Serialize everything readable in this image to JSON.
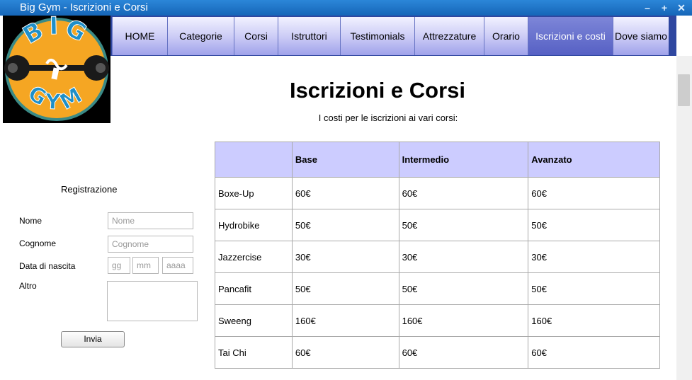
{
  "window": {
    "title": "Big Gym - Iscrizioni e Corsi"
  },
  "logo": {
    "top_text": "BIG",
    "bottom_text": "GYM"
  },
  "nav": {
    "items": [
      {
        "label": "HOME",
        "active": false
      },
      {
        "label": "Categorie",
        "active": false
      },
      {
        "label": "Corsi",
        "active": false
      },
      {
        "label": "Istruttori",
        "active": false
      },
      {
        "label": "Testimonials",
        "active": false
      },
      {
        "label": "Attrezzature",
        "active": false
      },
      {
        "label": "Orario",
        "active": false
      },
      {
        "label": "Iscrizioni e costi",
        "active": true
      },
      {
        "label": "Dove siamo",
        "active": false
      }
    ]
  },
  "main": {
    "title": "Iscrizioni e Corsi",
    "subtitle": "I costi per le iscrizioni ai vari corsi:"
  },
  "form": {
    "title": "Registrazione",
    "name_label": "Nome",
    "name_placeholder": "Nome",
    "surname_label": "Cognome",
    "surname_placeholder": "Cognome",
    "dob_label": "Data di nascita",
    "dob_day_placeholder": "gg",
    "dob_month_placeholder": "mm",
    "dob_year_placeholder": "aaaa",
    "other_label": "Altro",
    "submit_label": "Invia"
  },
  "table": {
    "headers": [
      "",
      "Base",
      "Intermedio",
      "Avanzato"
    ],
    "rows": [
      [
        "Boxe-Up",
        "60€",
        "60€",
        "60€"
      ],
      [
        "Hydrobike",
        "50€",
        "50€",
        "50€"
      ],
      [
        "Jazzercise",
        "30€",
        "30€",
        "30€"
      ],
      [
        "Pancafit",
        "50€",
        "50€",
        "50€"
      ],
      [
        "Sweeng",
        "160€",
        "160€",
        "160€"
      ],
      [
        "Tai Chi",
        "60€",
        "60€",
        "60€"
      ]
    ]
  },
  "colors": {
    "titlebar": "#1e76cc",
    "nav_border": "#2f47a0",
    "table_header": "#ccccff",
    "logo_orange": "#f5a623",
    "logo_blue": "#1f8fc8"
  }
}
